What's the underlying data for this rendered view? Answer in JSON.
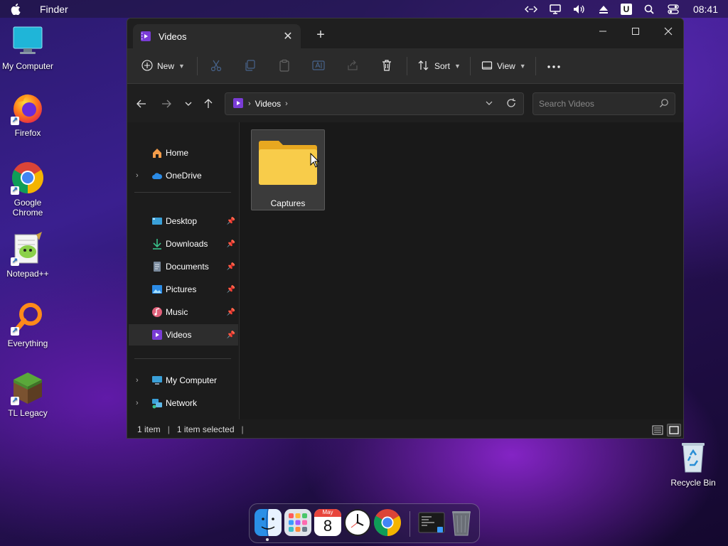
{
  "menubar": {
    "app_name": "Finder",
    "clock": "08:41",
    "u_badge": "U"
  },
  "desktop": {
    "icons": [
      {
        "label": "My Computer"
      },
      {
        "label": "Firefox"
      },
      {
        "label": "Google Chrome"
      },
      {
        "label": "Notepad++"
      },
      {
        "label": "Everything"
      },
      {
        "label": "TL Legacy"
      },
      {
        "label": "Recycle Bin"
      }
    ]
  },
  "window": {
    "tab_title": "Videos",
    "toolbar": {
      "new_label": "New",
      "sort_label": "Sort",
      "view_label": "View"
    },
    "address": {
      "crumb": "Videos"
    },
    "search": {
      "placeholder": "Search Videos"
    },
    "sidebar": {
      "items": [
        {
          "label": "Home"
        },
        {
          "label": "OneDrive"
        },
        {
          "label": "Desktop"
        },
        {
          "label": "Downloads"
        },
        {
          "label": "Documents"
        },
        {
          "label": "Pictures"
        },
        {
          "label": "Music"
        },
        {
          "label": "Videos"
        },
        {
          "label": "My Computer"
        },
        {
          "label": "Network"
        }
      ]
    },
    "content": {
      "items": [
        {
          "label": "Captures"
        }
      ]
    },
    "status": {
      "count": "1 item",
      "selected": "1 item selected",
      "divider": "|"
    }
  },
  "dock": {
    "calendar_month": "May",
    "calendar_day": "8"
  },
  "colors": {
    "accent": "#7a3cd6",
    "folder": "#f5c542",
    "selection": "#3b3b3b"
  }
}
